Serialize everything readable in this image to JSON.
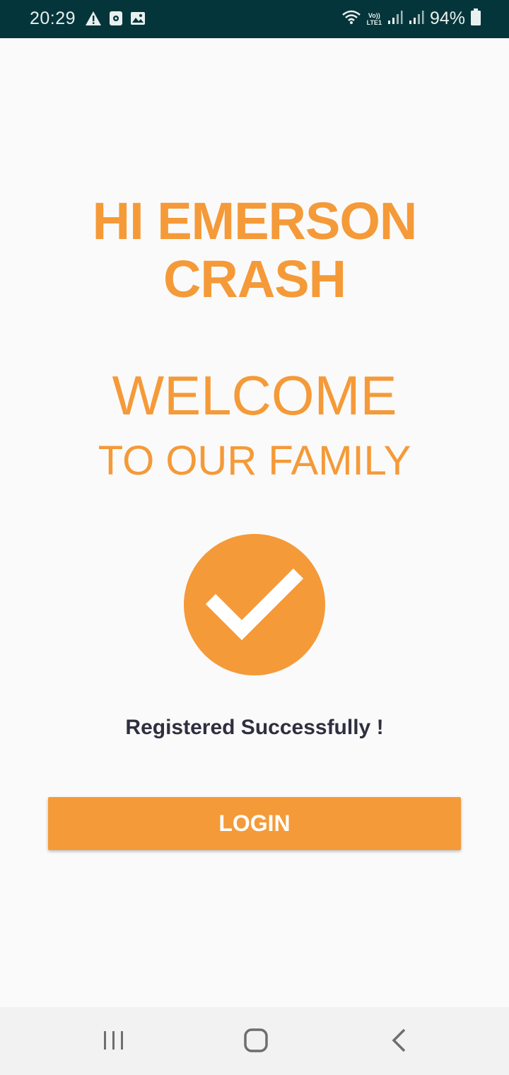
{
  "status_bar": {
    "time": "20:29",
    "battery_percent": "94%",
    "network_label_top": "Vo))",
    "network_label_bottom": "LTE1",
    "icons_left": [
      "warning-icon",
      "screen-record-icon",
      "image-icon"
    ],
    "icons_right": [
      "wifi-icon",
      "signal-icon",
      "signal-icon",
      "battery-icon"
    ],
    "bar_color": "#04353a"
  },
  "main": {
    "greeting": "HI EMERSON CRASH",
    "welcome_title": "WELCOME",
    "welcome_subtitle": "TO OUR FAMILY",
    "success_message": "Registered Successfully !",
    "login_label": "LOGIN",
    "accent_color": "#f59a38"
  },
  "nav_bar": {
    "buttons": [
      "recent-apps-icon",
      "home-icon",
      "back-icon"
    ]
  }
}
